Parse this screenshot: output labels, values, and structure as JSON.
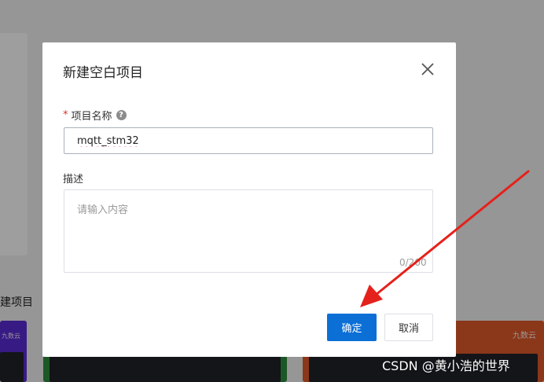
{
  "background": {
    "section_title": "建项目",
    "thumbnails": [
      {
        "logo": "九数云"
      },
      {
        "logo": ""
      },
      {
        "logo": "九数云"
      }
    ]
  },
  "dialog": {
    "title": "新建空白项目",
    "name_field": {
      "required_mark": "*",
      "label": "项目名称",
      "help_icon": "?",
      "value": "mqtt_stm32"
    },
    "desc_field": {
      "label": "描述",
      "placeholder": "请输入内容",
      "counter": "0/200"
    },
    "ok_label": "确定",
    "cancel_label": "取消"
  },
  "annotation": {
    "arrow_color": "#e5211b"
  },
  "watermark": "CSDN @黄小浩的世界"
}
